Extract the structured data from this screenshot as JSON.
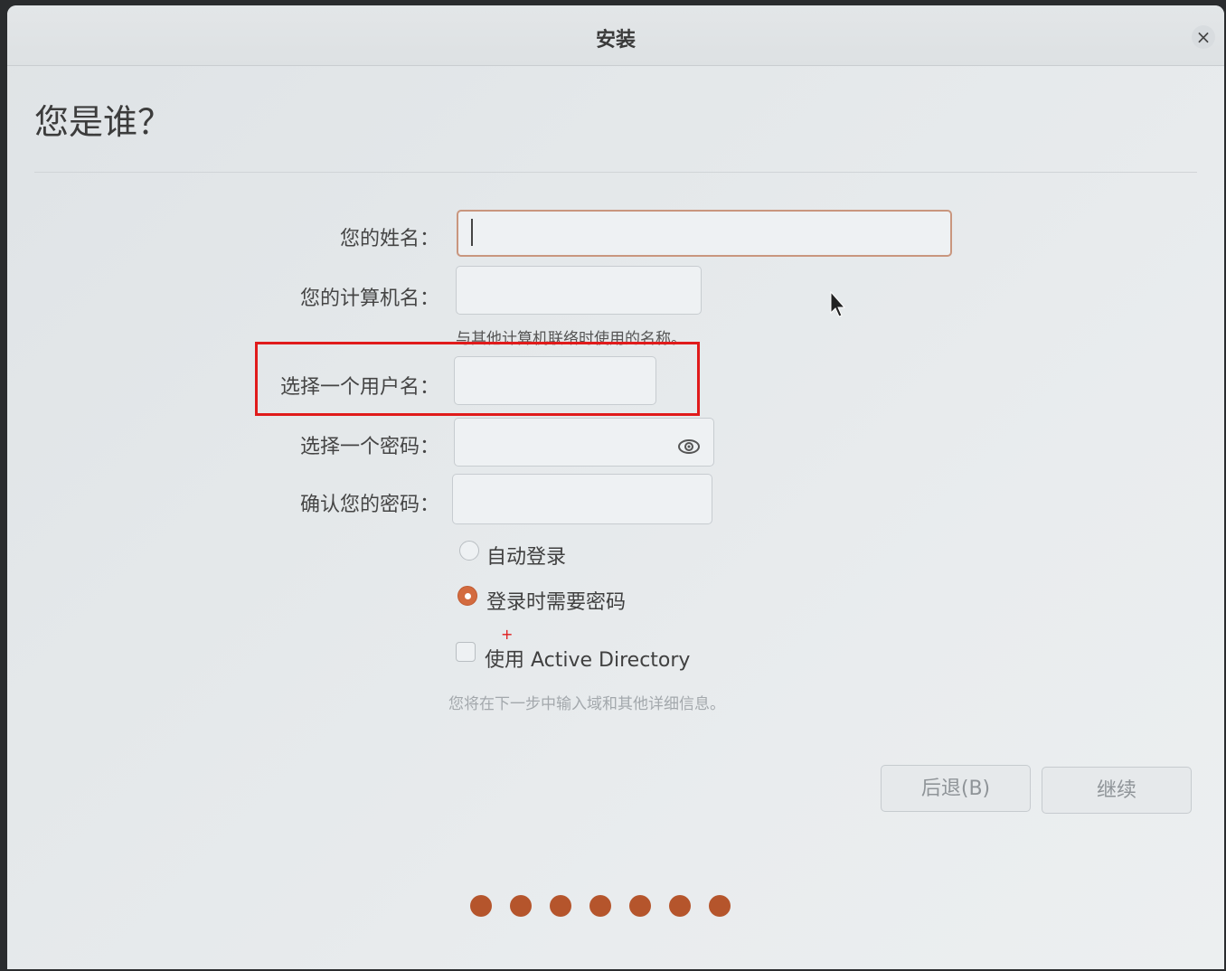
{
  "window": {
    "title": "安装",
    "close_label": "×"
  },
  "page": {
    "title": "您是谁？"
  },
  "form": {
    "name_label": "您的姓名：",
    "name_value": "",
    "computer_label": "您的计算机名：",
    "computer_value": "",
    "computer_hint": "与其他计算机联络时使用的名称。",
    "username_label": "选择一个用户名：",
    "username_value": "",
    "password_label": "选择一个密码：",
    "password_value": "",
    "confirm_label": "确认您的密码：",
    "confirm_value": ""
  },
  "login_options": {
    "auto_login_label": "自动登录",
    "auto_login_selected": false,
    "require_password_label": "登录时需要密码",
    "require_password_selected": true,
    "active_directory_label": "使用 Active Directory",
    "active_directory_checked": false,
    "active_directory_hint": "您将在下一步中输入域和其他详细信息。"
  },
  "buttons": {
    "back_label": "后退(B)",
    "continue_label": "继续"
  },
  "progress": {
    "total_steps": 7
  },
  "colors": {
    "accent": "#d36b3f",
    "highlight": "#e01b1b",
    "progress_dot": "#b5552c"
  },
  "icons": {
    "close": "close-icon",
    "eye": "eye-icon",
    "pointer": "mouse-pointer-icon"
  }
}
